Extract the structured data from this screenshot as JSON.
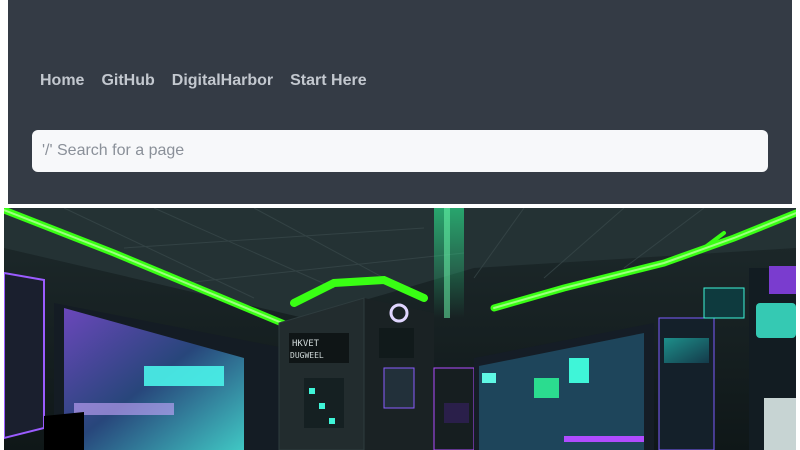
{
  "nav": {
    "items": [
      {
        "label": "Home"
      },
      {
        "label": "GitHub"
      },
      {
        "label": "DigitalHarbor"
      },
      {
        "label": "Start Here"
      }
    ]
  },
  "search": {
    "placeholder": "'/' Search for a page",
    "value": ""
  },
  "colors": {
    "header_bg": "#343b45",
    "nav_text": "#c3c8cf",
    "neon_green": "#39ff14",
    "neon_cyan": "#3ff5d8",
    "neon_purple": "#b04cff"
  },
  "hero": {
    "image": "cyberpunk-server-room-illustration"
  }
}
